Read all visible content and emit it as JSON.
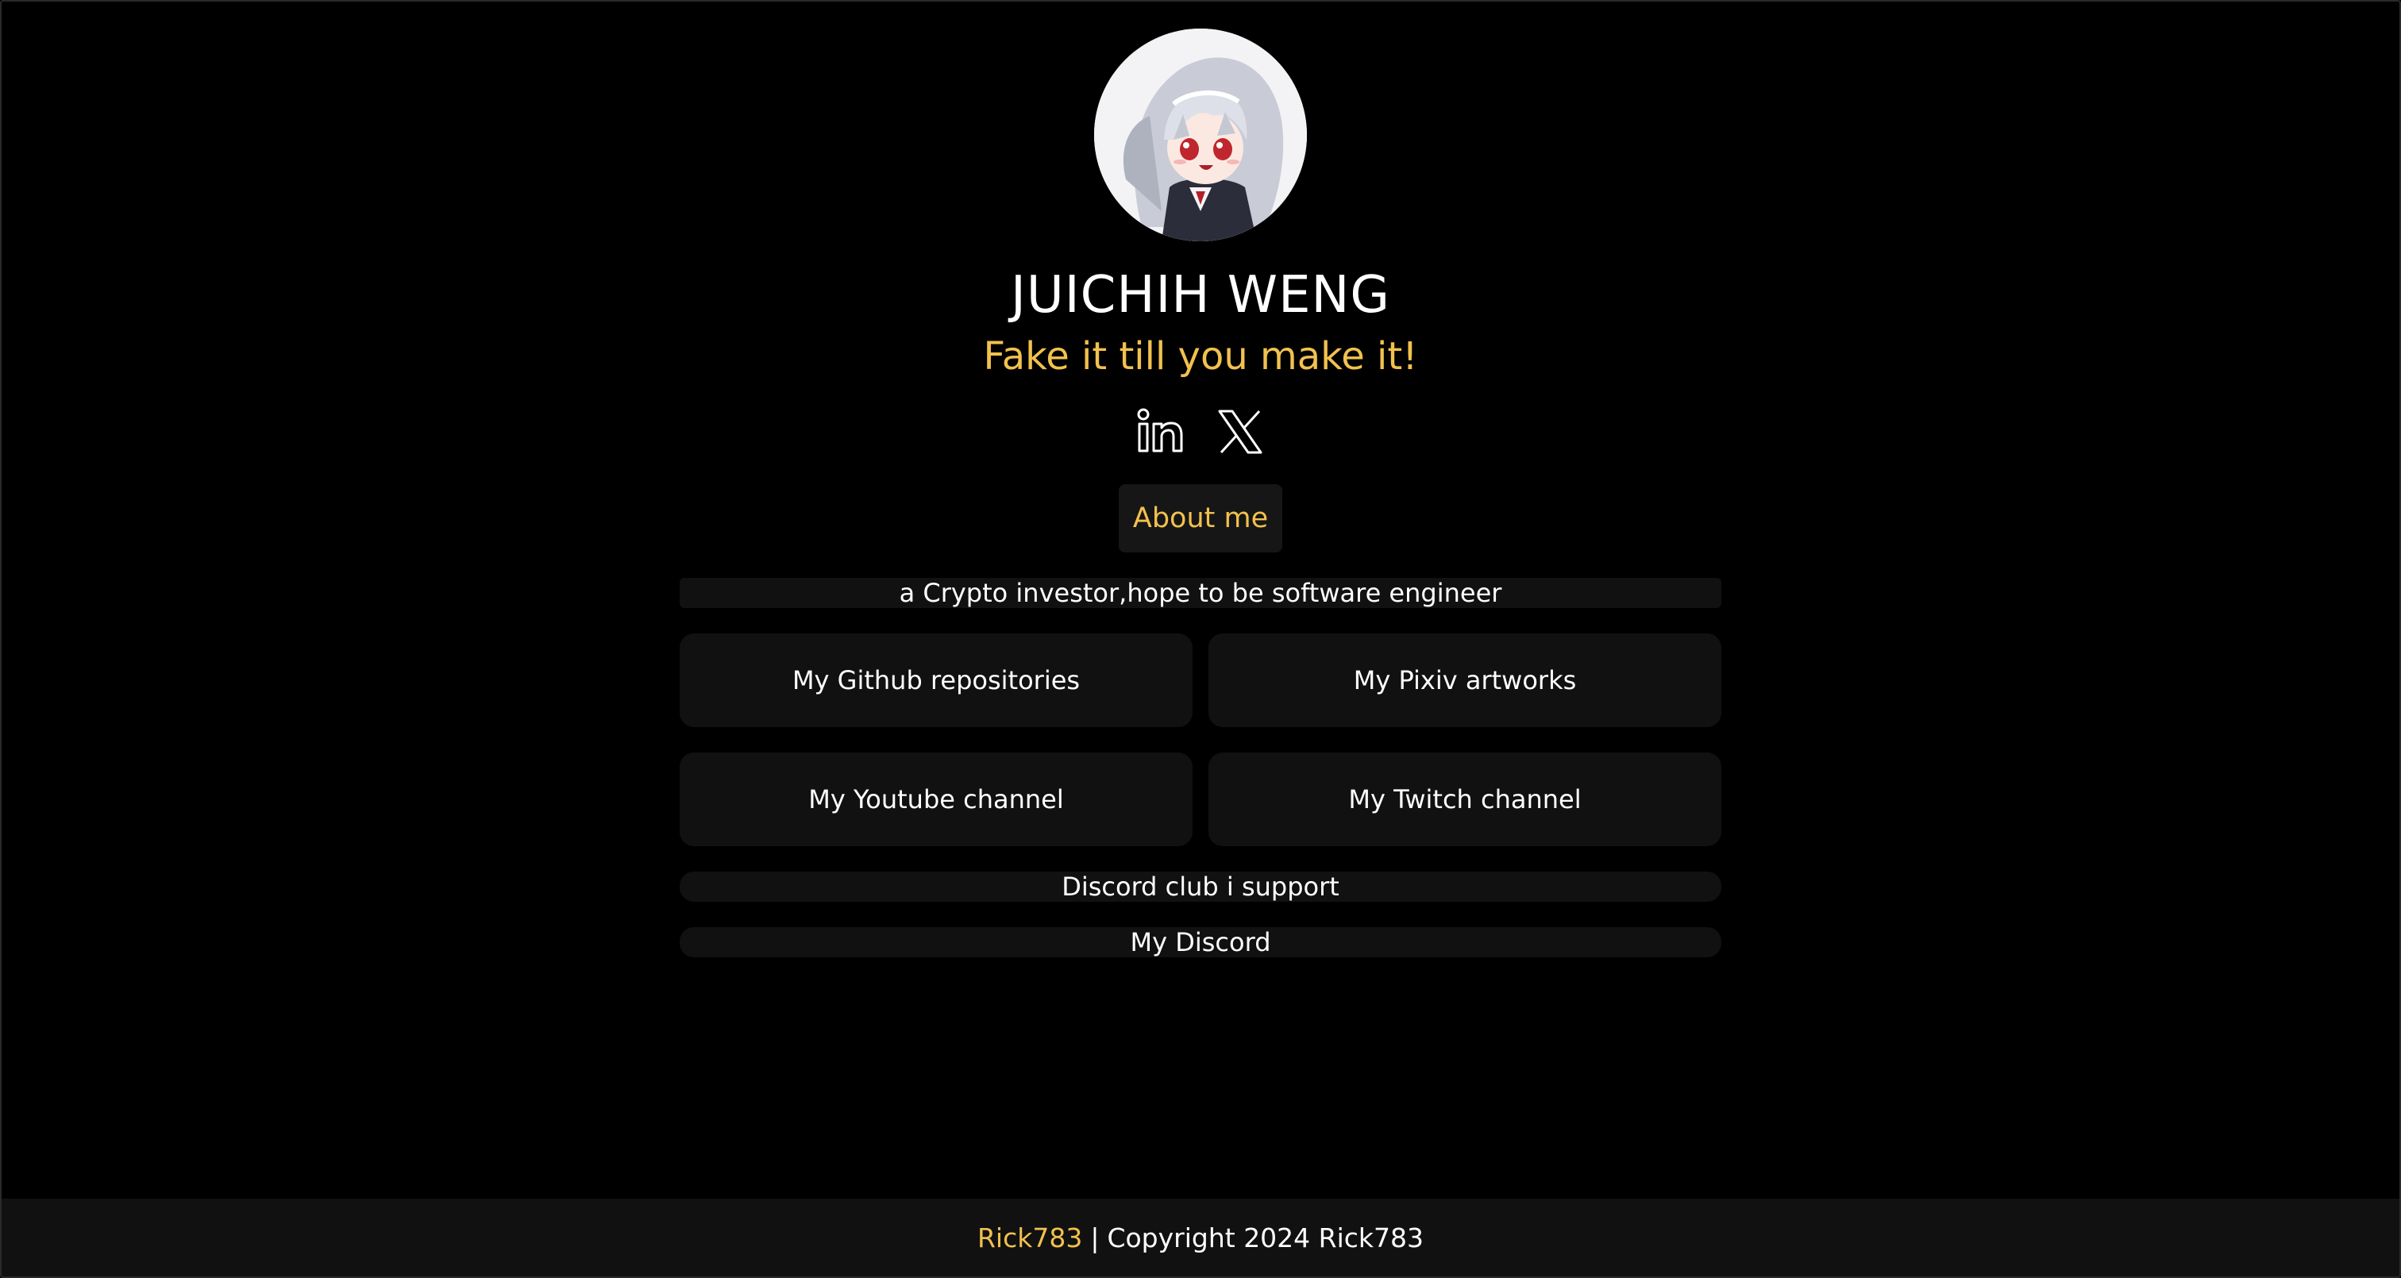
{
  "profile": {
    "name": "JUICHIH WENG",
    "tagline": "Fake it till you make it!",
    "avatar_icon": "anime-character-avatar"
  },
  "socials": [
    {
      "icon": "linkedin-icon"
    },
    {
      "icon": "x-twitter-icon"
    }
  ],
  "about_button": "About me",
  "bio": "a Crypto investor,hope to be software engineer",
  "links": {
    "github": "My Github repositories",
    "pixiv": "My Pixiv artworks",
    "youtube": "My Youtube channel",
    "twitch": "My Twitch channel",
    "discord_club": "Discord club i support",
    "discord": "My Discord"
  },
  "footer": {
    "brand": "Rick783",
    "separator": "|",
    "copyright": "Copyright 2024 Rick783"
  },
  "colors": {
    "background": "#000000",
    "accent": "#f2c14e",
    "card": "#111111"
  }
}
